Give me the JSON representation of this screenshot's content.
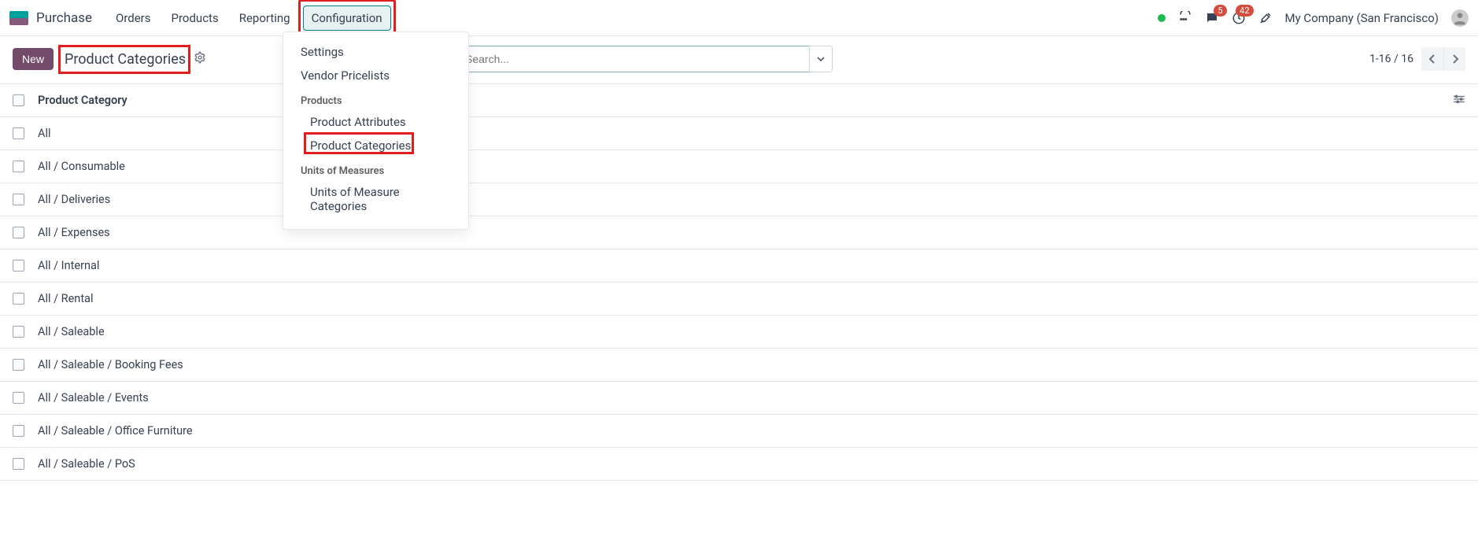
{
  "nav": {
    "app_title": "Purchase",
    "items": [
      "Orders",
      "Products",
      "Reporting",
      "Configuration"
    ],
    "active_index": 3
  },
  "dropdown": {
    "settings": "Settings",
    "vendor_pricelists": "Vendor Pricelists",
    "products_header": "Products",
    "product_attributes": "Product Attributes",
    "product_categories": "Product Categories",
    "uom_header": "Units of Measures",
    "uom_categories": "Units of Measure Categories"
  },
  "topright": {
    "msg_badge": "5",
    "activity_badge": "42",
    "company": "My Company (San Francisco)"
  },
  "controls": {
    "new_label": "New",
    "breadcrumb": "Product Categories",
    "search_placeholder": "Search...",
    "search_value": "",
    "pager": "1-16 / 16"
  },
  "table": {
    "header": "Product Category",
    "rows": [
      "All",
      "All / Consumable",
      "All / Deliveries",
      "All / Expenses",
      "All / Internal",
      "All / Rental",
      "All / Saleable",
      "All / Saleable / Booking Fees",
      "All / Saleable / Events",
      "All / Saleable / Office Furniture",
      "All / Saleable / PoS"
    ]
  }
}
